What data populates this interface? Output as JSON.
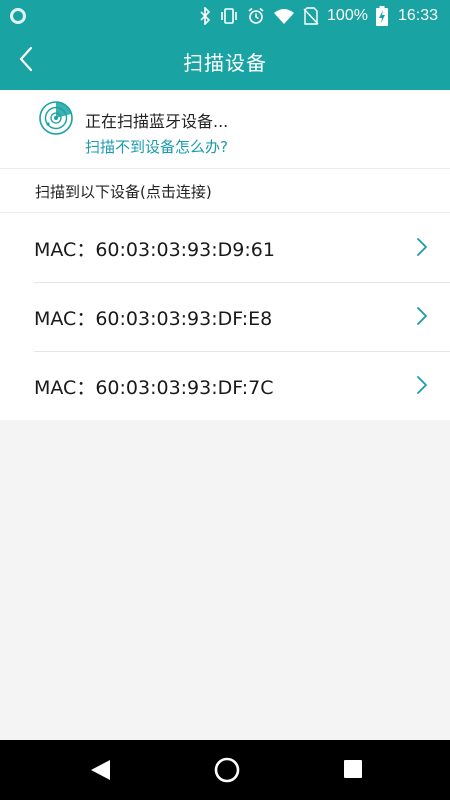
{
  "status_bar": {
    "battery_percent": "100%",
    "time": "16:33",
    "icons": [
      "app-notification-icon",
      "bluetooth-icon",
      "vibrate-icon",
      "alarm-icon",
      "wifi-icon",
      "no-sim-icon",
      "battery-charging-icon"
    ]
  },
  "header": {
    "title": "扫描设备",
    "back_icon": "chevron-left-icon"
  },
  "scan": {
    "status": "正在扫描蓝牙设备...",
    "help_link": "扫描不到设备怎么办?",
    "icon": "radar-icon"
  },
  "devices_section": {
    "label": "扫描到以下设备(点击连接)",
    "items": [
      {
        "label": "MAC：60:03:03:93:D9:61"
      },
      {
        "label": "MAC：60:03:03:93:DF:E8"
      },
      {
        "label": "MAC：60:03:03:93:DF:7C"
      }
    ]
  },
  "nav_bar": {
    "icons": [
      "nav-back-icon",
      "nav-home-icon",
      "nav-recents-icon"
    ]
  },
  "colors": {
    "primary": "#1aa3a3",
    "link": "#1a9bb0",
    "background": "#f4f4f4"
  }
}
